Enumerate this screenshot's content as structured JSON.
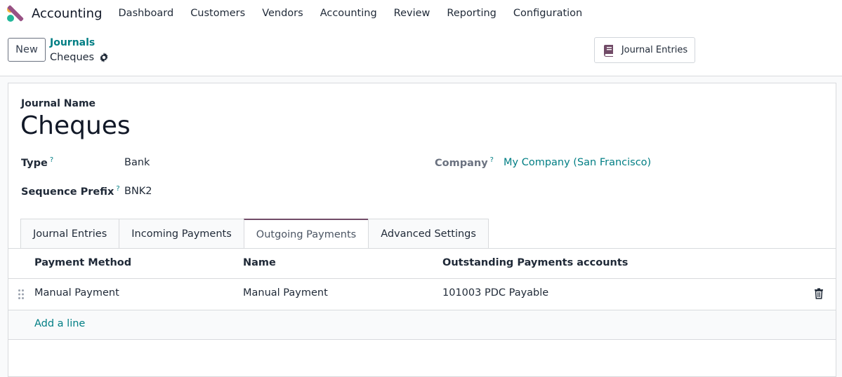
{
  "navbar": {
    "app_name": "Accounting",
    "menu": [
      "Dashboard",
      "Customers",
      "Vendors",
      "Accounting",
      "Review",
      "Reporting",
      "Configuration"
    ]
  },
  "control": {
    "new_label": "New",
    "breadcrumb_parent": "Journals",
    "breadcrumb_current": "Cheques",
    "journal_entries_button": "Journal Entries"
  },
  "form": {
    "journal_name_label": "Journal Name",
    "journal_name": "Cheques",
    "type_label": "Type",
    "type_help": "?",
    "type_value": "Bank",
    "sequence_label": "Sequence Prefix",
    "sequence_help": "?",
    "sequence_value": "BNK2",
    "company_label": "Company",
    "company_help": "?",
    "company_value": "My Company (San Francisco)"
  },
  "tabs": [
    "Journal Entries",
    "Incoming Payments",
    "Outgoing Payments",
    "Advanced Settings"
  ],
  "active_tab": "Outgoing Payments",
  "table": {
    "headers": [
      "Payment Method",
      "Name",
      "Outstanding Payments accounts"
    ],
    "rows": [
      [
        "Manual Payment",
        "Manual Payment",
        "101003 PDC Payable"
      ]
    ],
    "add_line": "Add a line"
  },
  "colors": {
    "accent_teal": "#017e84",
    "brand_purple": "#714b67"
  },
  "icons": [
    "app-logo-icon",
    "gear-icon",
    "book-icon",
    "drag-handle-icon",
    "trash-icon"
  ]
}
